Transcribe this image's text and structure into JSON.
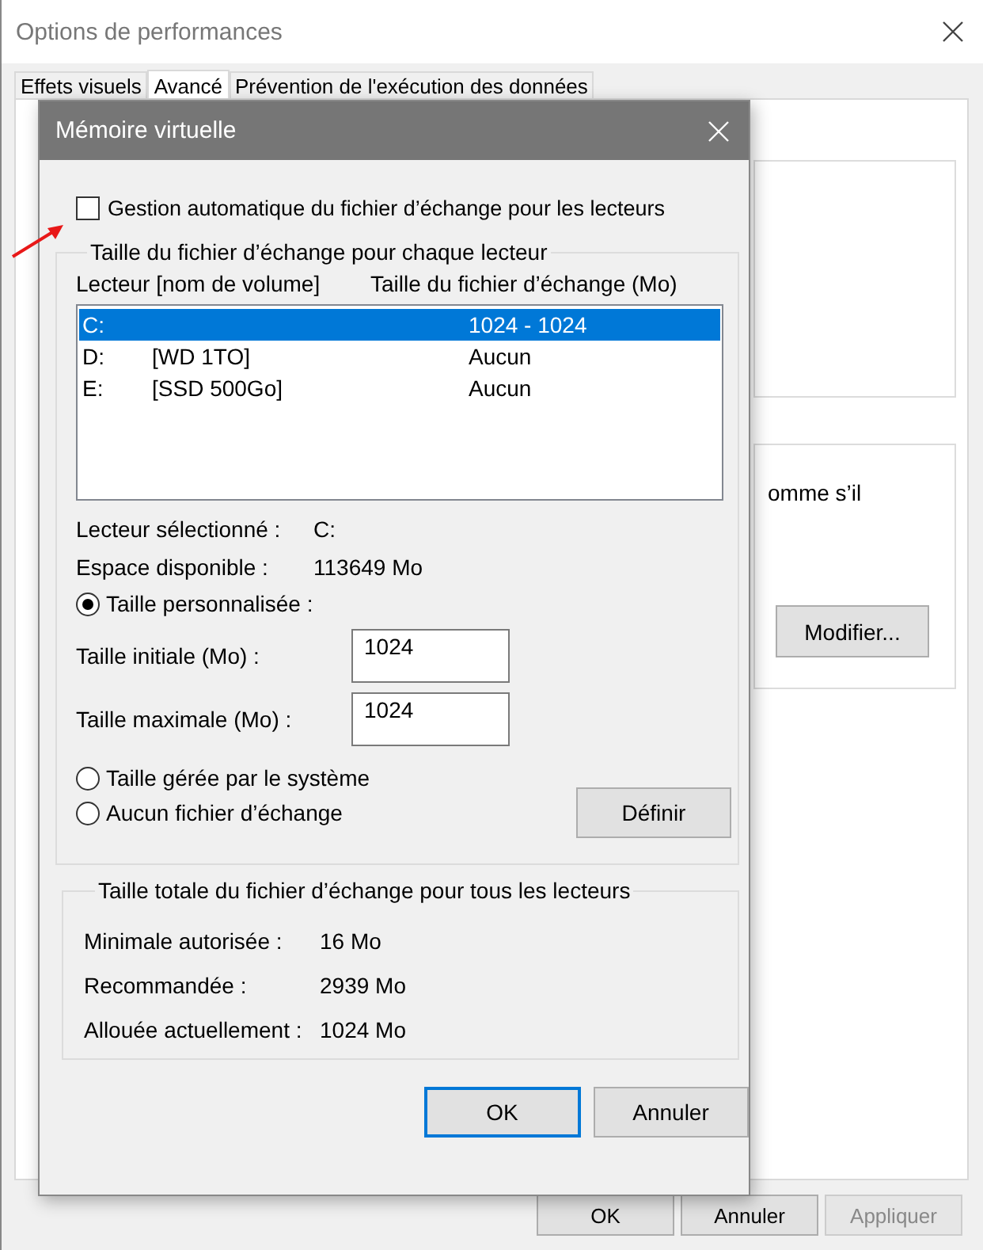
{
  "background_window": {
    "title": "Options de performances",
    "tabs": [
      {
        "label": "Effets visuels",
        "selected": false
      },
      {
        "label": "Avancé",
        "selected": true
      },
      {
        "label": "Prévention de l'exécution des données",
        "selected": false
      }
    ],
    "partial_text": "omme s’il",
    "modify_button": "Modifier...",
    "buttons": [
      {
        "label": "OK",
        "disabled": false
      },
      {
        "label": "Annuler",
        "disabled": false
      },
      {
        "label": "Appliquer",
        "disabled": true
      }
    ]
  },
  "dialog": {
    "title": "Mémoire virtuelle",
    "auto_manage": {
      "label": "Gestion automatique du fichier d’échange pour les lecteurs",
      "checked": false
    },
    "drives_group": {
      "title": "Taille du fichier d’échange pour chaque lecteur",
      "columns": [
        "Lecteur [nom de volume]",
        "Taille du fichier d’échange (Mo)"
      ],
      "drives": [
        {
          "letter": "C:",
          "size": "1024 - 1024",
          "selected": true
        },
        {
          "letter": "D:",
          "volume": "[WD 1TO]",
          "size": "Aucun",
          "selected": false
        },
        {
          "letter": "E:",
          "volume": "[SSD 500Go]",
          "size": "Aucun",
          "selected": false
        }
      ],
      "info": [
        {
          "label": "Lecteur sélectionné :",
          "value": "C:"
        },
        {
          "label": "Espace disponible :",
          "value": "113649 Mo"
        }
      ],
      "radios": [
        {
          "label": "Taille personnalisée :",
          "selected": true
        },
        {
          "label": "Taille gérée par le système",
          "selected": false
        },
        {
          "label": "Aucun fichier d’échange",
          "selected": false
        }
      ],
      "fields": [
        {
          "label": "Taille initiale (Mo) :",
          "value": "1024"
        },
        {
          "label": "Taille maximale (Mo) :",
          "value": "1024"
        }
      ],
      "set_button": "Définir"
    },
    "totals_group": {
      "title": "Taille totale du fichier d’échange pour tous les lecteurs",
      "rows": [
        {
          "label": "Minimale autorisée :",
          "value": "16 Mo"
        },
        {
          "label": "Recommandée :",
          "value": "2939 Mo"
        },
        {
          "label": "Allouée actuellement :",
          "value": "1024 Mo"
        }
      ]
    },
    "buttons": [
      {
        "label": "OK",
        "default": true
      },
      {
        "label": "Annuler",
        "default": false
      }
    ]
  }
}
